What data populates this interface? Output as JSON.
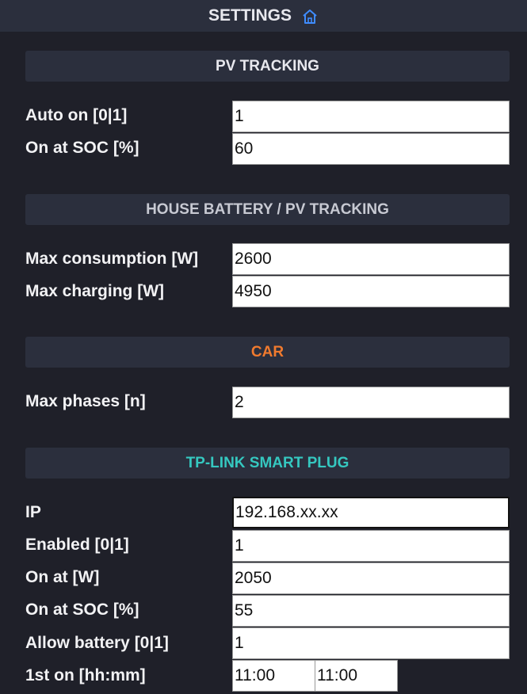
{
  "title": "SETTINGS",
  "header_icon": "home-icon",
  "colors": {
    "background": "#1f2029",
    "panel": "#2b2f3d",
    "pv_header": "#e8e8ee",
    "battery_header": "#c7c9d2",
    "car_header": "#f07a2e",
    "plug_header": "#35c8c0",
    "home_icon": "#3f8cff"
  },
  "sections": {
    "pv": {
      "title": "PV TRACKING",
      "fields": [
        {
          "label": "Auto on [0|1]",
          "value": "1"
        },
        {
          "label": "On at SOC [%]",
          "value": "60"
        }
      ]
    },
    "battery": {
      "title": "HOUSE BATTERY / PV TRACKING",
      "fields": [
        {
          "label": "Max consumption [W]",
          "value": "2600"
        },
        {
          "label": "Max charging [W]",
          "value": "4950"
        }
      ]
    },
    "car": {
      "title": "CAR",
      "fields": [
        {
          "label": "Max phases [n]",
          "value": "2"
        }
      ]
    },
    "plug": {
      "title": "TP-LINK SMART PLUG",
      "fields": [
        {
          "label": "IP",
          "value": "192.168.xx.xx"
        },
        {
          "label": "Enabled [0|1]",
          "value": "1"
        },
        {
          "label": "On at [W]",
          "value": "2050"
        },
        {
          "label": "On at SOC [%]",
          "value": "55"
        },
        {
          "label": "Allow battery [0|1]",
          "value": "1"
        },
        {
          "label": "1st on [hh:mm]",
          "value_from": "11:00",
          "value_to": "11:00"
        }
      ]
    }
  }
}
